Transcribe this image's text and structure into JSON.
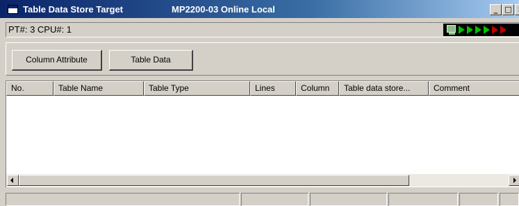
{
  "window": {
    "title": "Table Data Store Target",
    "subtitle": "MP2200-03 Online  Local",
    "minimize_glyph": "_",
    "maximize_glyph": "□",
    "close_glyph": "×"
  },
  "status_line": {
    "text": "PT#: 3 CPU#: 1",
    "indicator_icon": "pc-icon",
    "indicator_colors": [
      "#00c000",
      "#00c000",
      "#00c000",
      "#00c000",
      "#c00000",
      "#c00000"
    ]
  },
  "toolbar": {
    "column_attribute_label": "Column Attribute",
    "table_data_label": "Table Data"
  },
  "table": {
    "columns": [
      "No.",
      "Table Name",
      "Table Type",
      "Lines",
      "Column",
      "Table data store...",
      "Comment"
    ],
    "rows": []
  },
  "statusbar": {
    "panels": [
      "",
      "",
      "",
      "",
      "",
      ""
    ]
  }
}
